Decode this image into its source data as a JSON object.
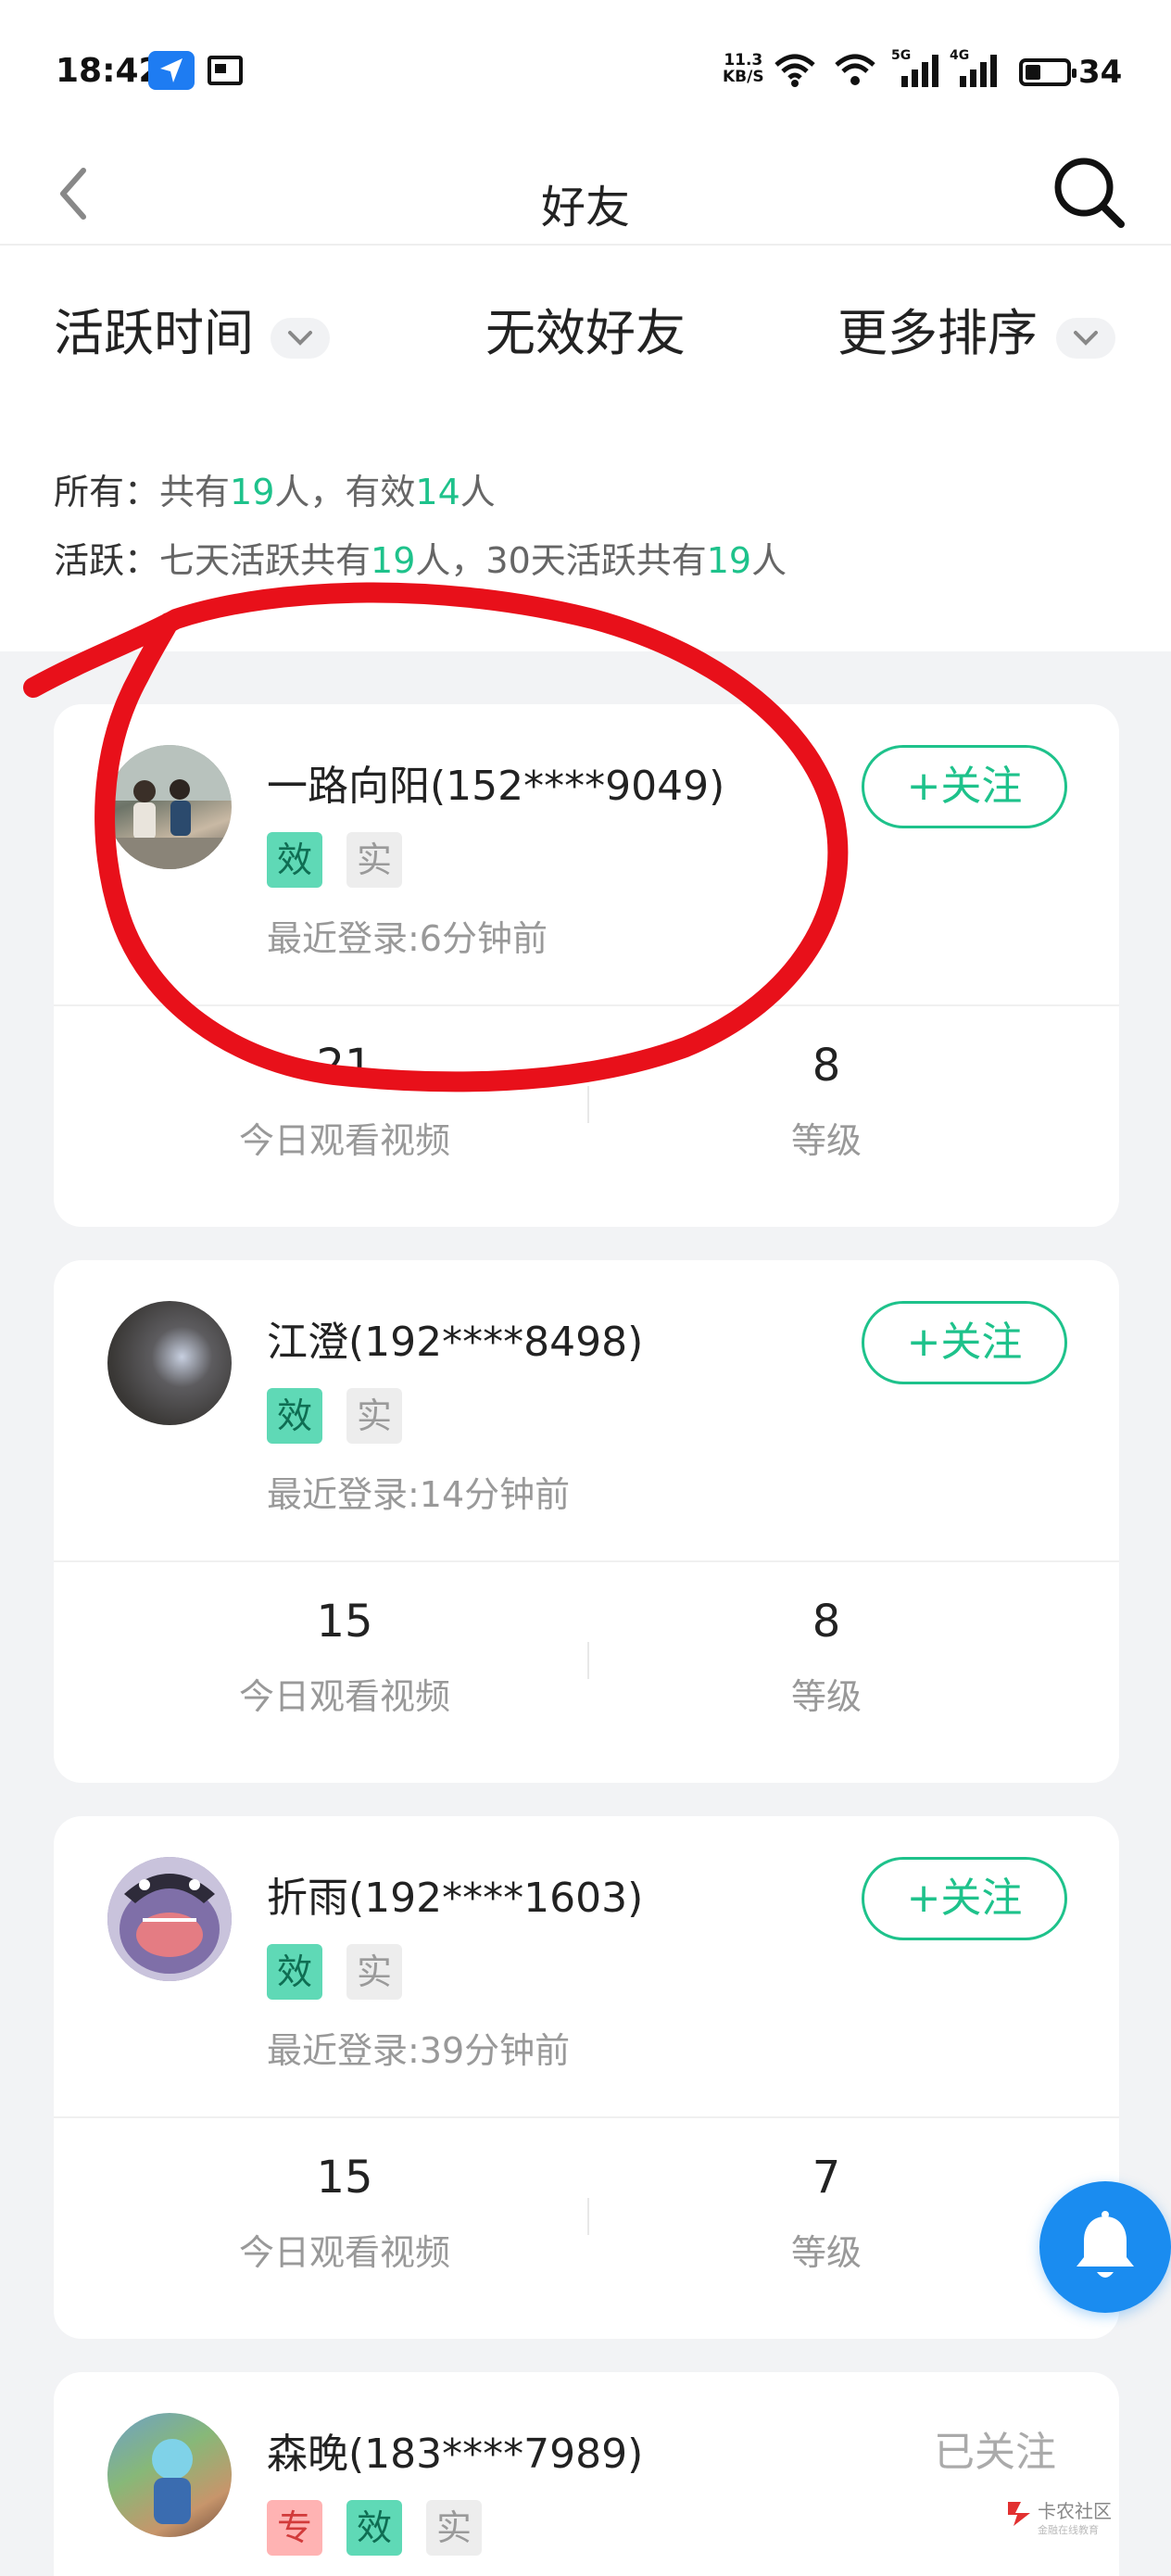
{
  "status_bar": {
    "time": "18:42",
    "net_speed": "11.3",
    "net_unit": "KB/S",
    "sig1_tag": "5G",
    "sig2_tag": "4G",
    "battery": "34"
  },
  "nav": {
    "title": "好友"
  },
  "tabs": {
    "active_time": "活跃时间",
    "invalid_friends": "无效好友",
    "more_sort": "更多排序"
  },
  "summary": {
    "all_label": "所有：",
    "all_pre": "共有",
    "all_count": "19",
    "all_mid": "人，有效",
    "all_valid": "14",
    "all_post": "人",
    "active_label": "活跃：",
    "active_pre": "七天活跃共有",
    "active_7": "19",
    "active_mid": "人，30天活跃共有",
    "active_30": "19",
    "active_post": "人"
  },
  "friends": [
    {
      "name": "一路向阳(152****9049)",
      "badges": [
        "效",
        "实"
      ],
      "last_login": "最近登录:6分钟前",
      "action": "+关注",
      "videos_today": "21",
      "videos_label": "今日观看视频",
      "level": "8",
      "level_label": "等级"
    },
    {
      "name": "江澄(192****8498)",
      "badges": [
        "效",
        "实"
      ],
      "last_login": "最近登录:14分钟前",
      "action": "+关注",
      "videos_today": "15",
      "videos_label": "今日观看视频",
      "level": "8",
      "level_label": "等级"
    },
    {
      "name": "折雨(192****1603)",
      "badges": [
        "效",
        "实"
      ],
      "last_login": "最近登录:39分钟前",
      "action": "+关注",
      "videos_today": "15",
      "videos_label": "今日观看视频",
      "level": "7",
      "level_label": "等级"
    },
    {
      "name": "森晚(183****7989)",
      "badges": [
        "专",
        "效",
        "实"
      ],
      "action": "已关注"
    }
  ],
  "watermark": {
    "text": "卡农社区",
    "sub": "金融在线教育"
  },
  "colors": {
    "accent_green": "#1ec28b",
    "bell_blue": "#1a8cf0",
    "annotation_red": "#e8101a"
  }
}
